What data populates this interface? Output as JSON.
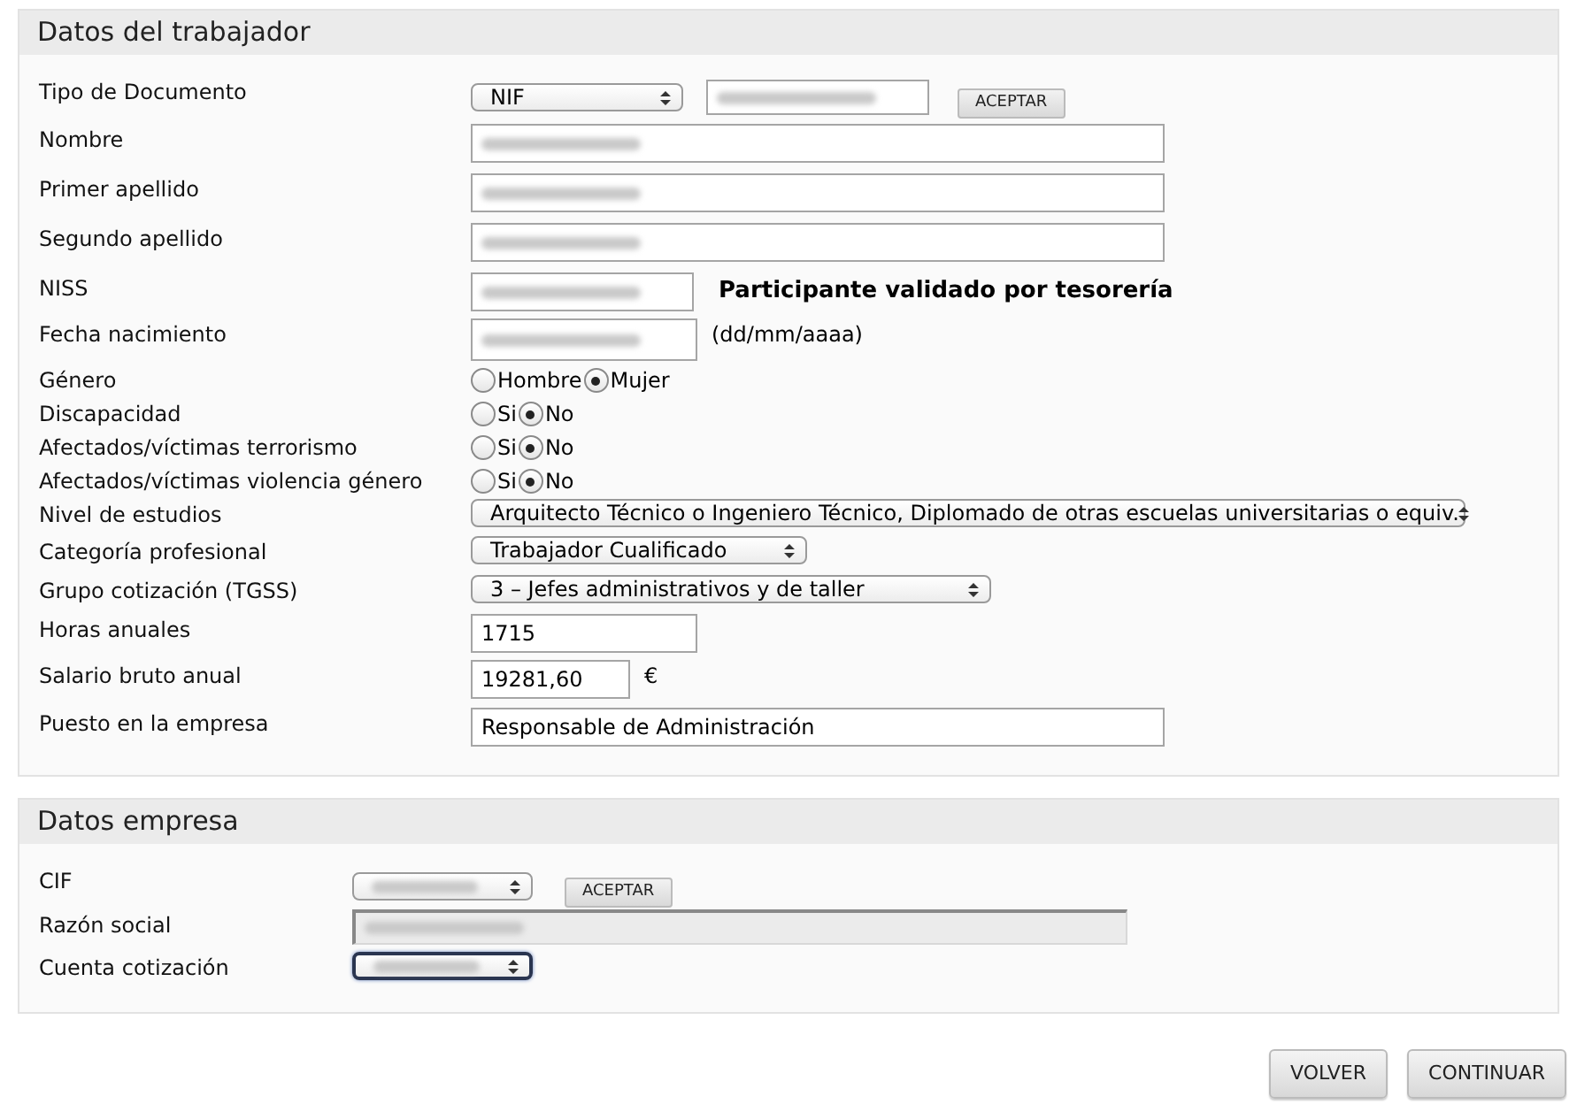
{
  "worker": {
    "title": "Datos del trabajador",
    "rows": [
      {
        "kind": "document",
        "label": "Tipo de Documento",
        "select": {
          "value": "NIF"
        },
        "input": {
          "redacted": true
        },
        "button": "ACEPTAR"
      },
      {
        "kind": "wide_input",
        "label": "Nombre",
        "input": {
          "redacted": true
        }
      },
      {
        "kind": "wide_input",
        "label": "Primer apellido",
        "input": {
          "redacted": true
        }
      },
      {
        "kind": "wide_input",
        "label": "Segundo apellido",
        "input": {
          "redacted": true
        }
      },
      {
        "kind": "short_input",
        "label": "NISS",
        "input": {
          "redacted": true
        },
        "note": "Participante validado por tesorería",
        "note_bold": true
      },
      {
        "kind": "short_input",
        "label": "Fecha nacimiento",
        "input": {
          "redacted": true
        },
        "note": "(dd/mm/aaaa)",
        "note_bold": false
      },
      {
        "kind": "radio",
        "label": "Género",
        "options": [
          {
            "label": "Hombre",
            "selected": false
          },
          {
            "label": "Mujer",
            "selected": true
          }
        ]
      },
      {
        "kind": "radio",
        "label": "Discapacidad",
        "options": [
          {
            "label": "Si",
            "selected": false
          },
          {
            "label": "No",
            "selected": true
          }
        ]
      },
      {
        "kind": "radio",
        "label": "Afectados/víctimas terrorismo",
        "options": [
          {
            "label": "Si",
            "selected": false
          },
          {
            "label": "No",
            "selected": true
          }
        ]
      },
      {
        "kind": "radio",
        "label": "Afectados/víctimas violencia género",
        "options": [
          {
            "label": "Si",
            "selected": false
          },
          {
            "label": "No",
            "selected": true
          }
        ]
      },
      {
        "kind": "select_long",
        "label": "Nivel de estudios",
        "select": {
          "value": "Arquitecto Técnico o Ingeniero Técnico, Diplomado de otras escuelas universitarias o equiv."
        }
      },
      {
        "kind": "select_short",
        "label": "Categoría profesional",
        "select": {
          "value": "Trabajador Cualificado"
        }
      },
      {
        "kind": "select_medium",
        "label": "Grupo cotización (TGSS)",
        "select": {
          "value": "3 – Jefes administrativos y de taller"
        }
      },
      {
        "kind": "short_input",
        "label": "Horas anuales",
        "input": {
          "value": "1715"
        }
      },
      {
        "kind": "money_input",
        "label": "Salario bruto anual",
        "input": {
          "value": "19281,60"
        },
        "note": "€",
        "note_bold": false
      },
      {
        "kind": "wide_input",
        "label": "Puesto en la empresa",
        "input": {
          "value": "Responsable de Administración"
        }
      }
    ]
  },
  "company": {
    "title": "Datos empresa",
    "rows": [
      {
        "kind": "select_button",
        "label": "CIF",
        "select": {
          "redacted": true
        },
        "button": "ACEPTAR"
      },
      {
        "kind": "readonly_input",
        "label": "Razón social",
        "input": {
          "redacted": true
        }
      },
      {
        "kind": "select_focused",
        "label": "Cuenta cotización",
        "select": {
          "redacted": true
        }
      }
    ]
  },
  "buttons": [
    "VOLVER",
    "CONTINUAR"
  ]
}
